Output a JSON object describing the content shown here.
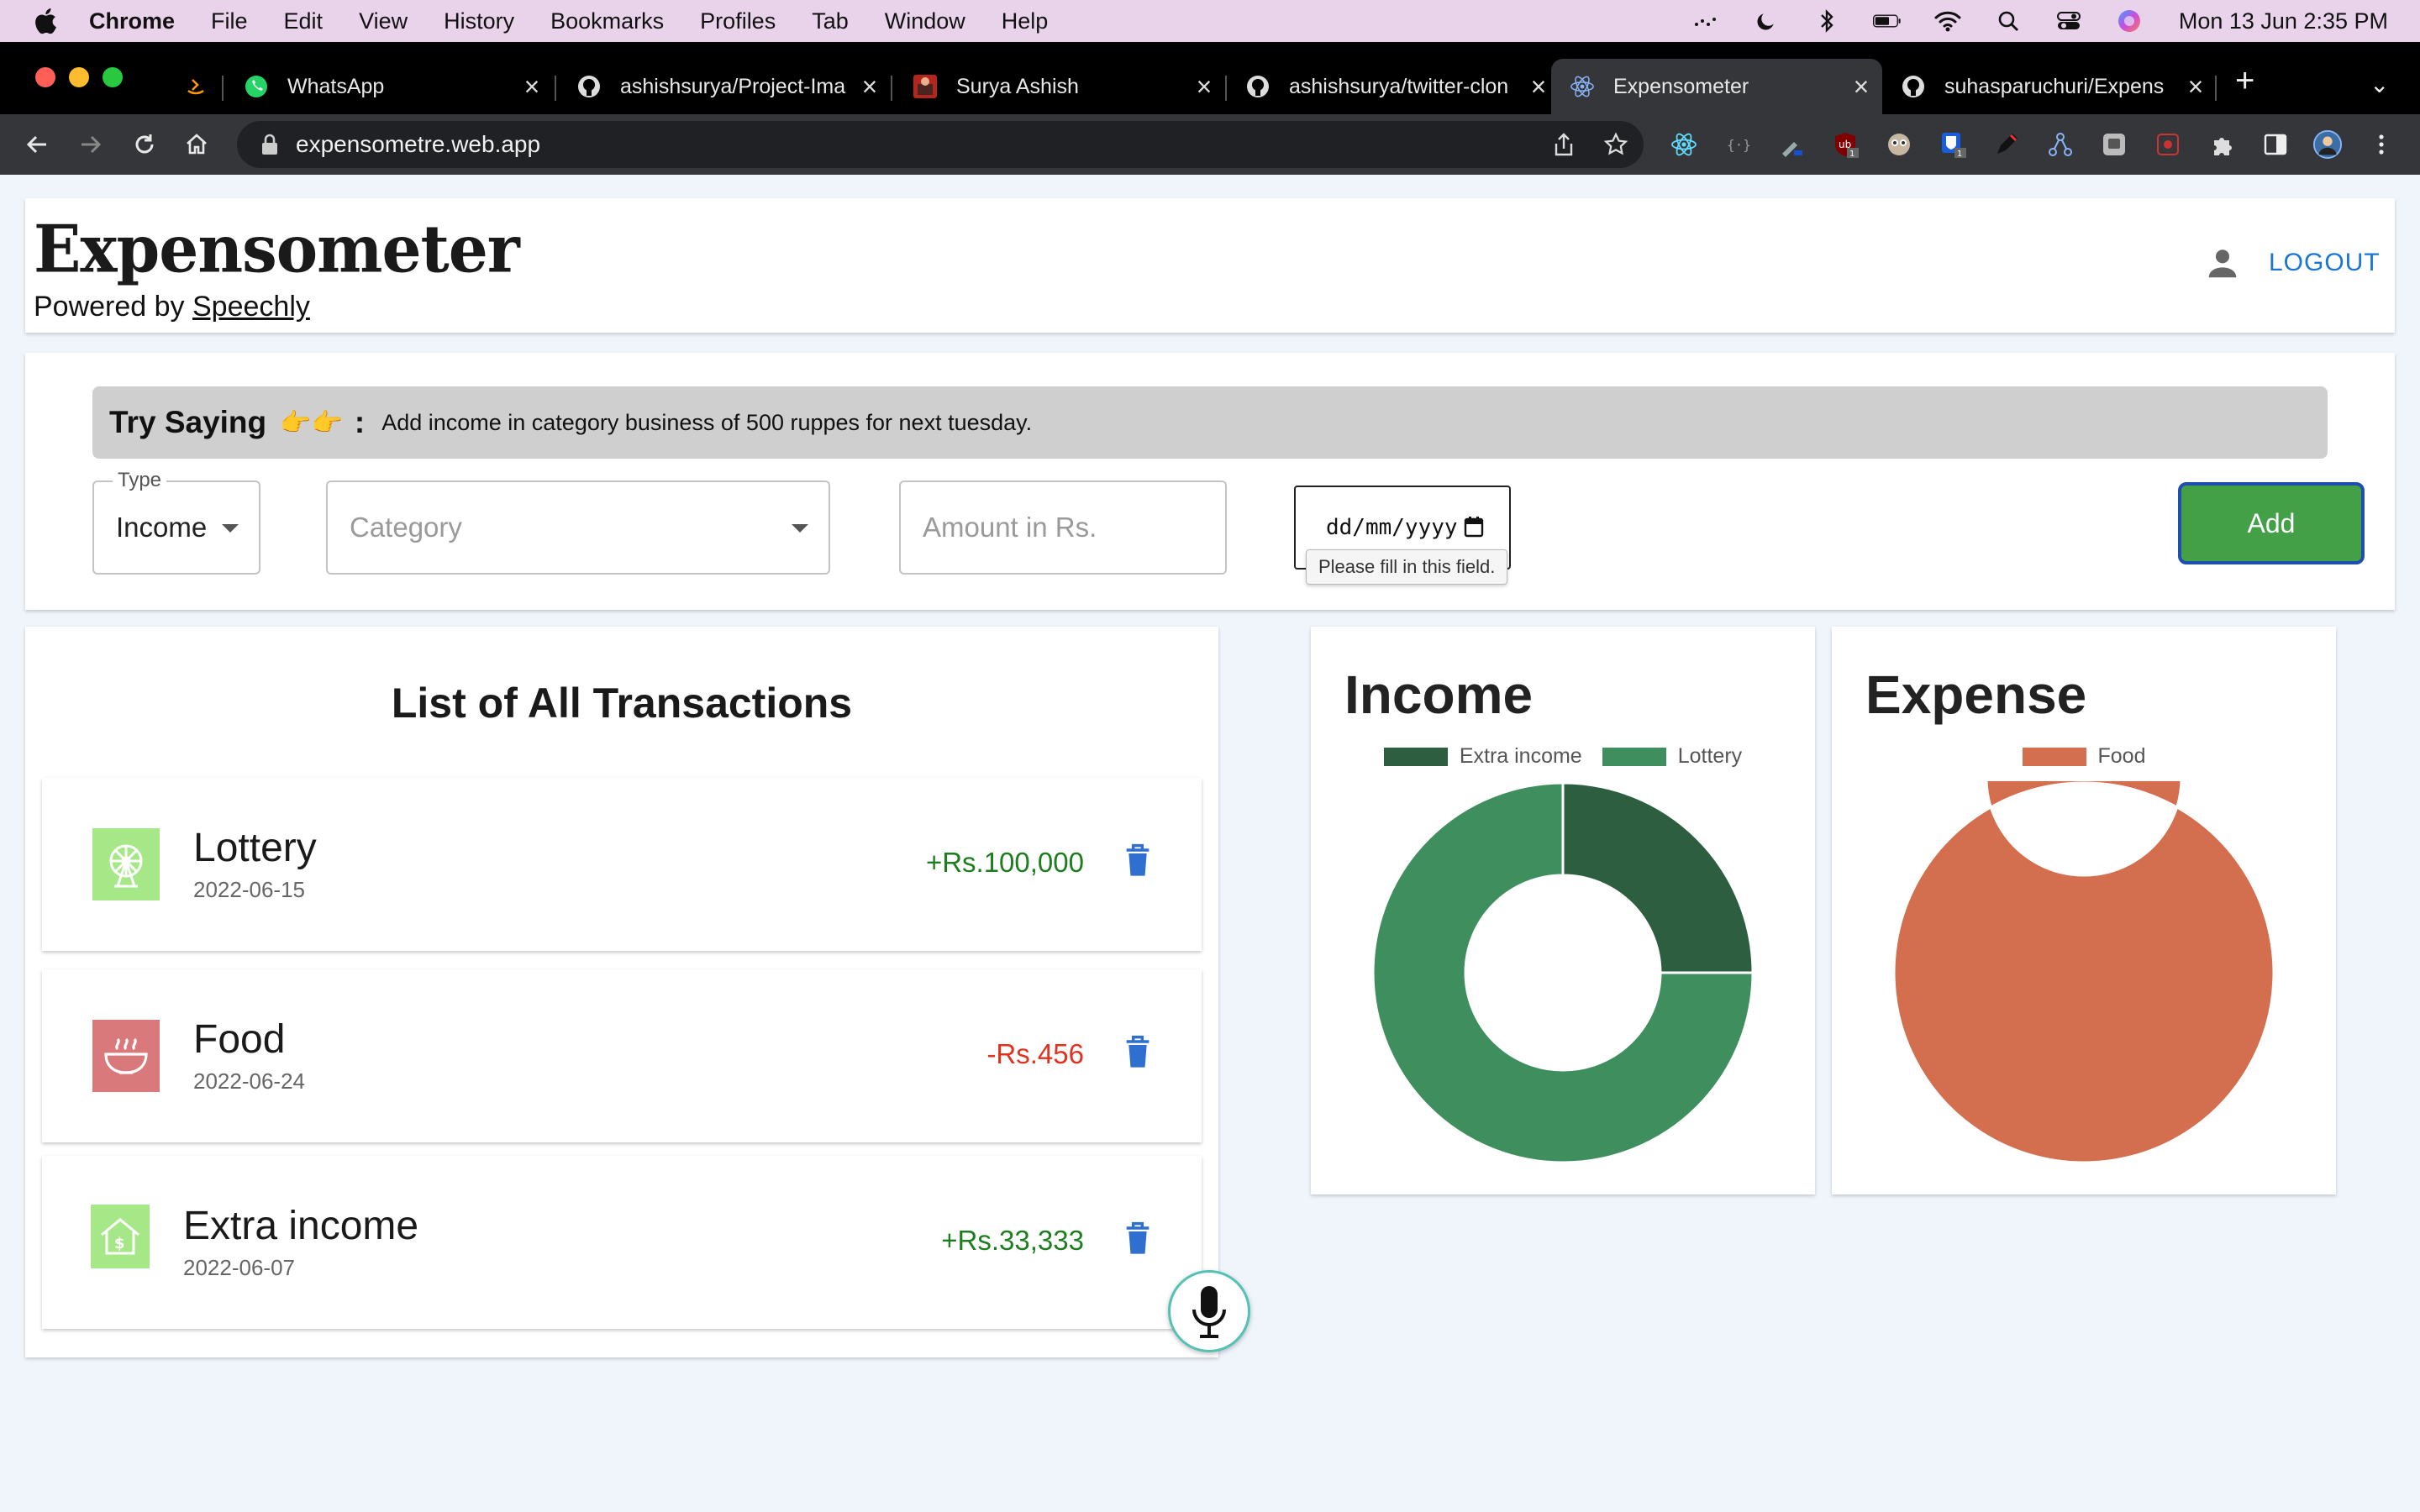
{
  "menubar": {
    "app": "Chrome",
    "items": [
      "File",
      "Edit",
      "View",
      "History",
      "Bookmarks",
      "Profiles",
      "Tab",
      "Window",
      "Help"
    ],
    "clock": "Mon 13 Jun  2:35 PM"
  },
  "browser": {
    "tabs": [
      {
        "title": "",
        "icon": "amazon-icon",
        "active": false
      },
      {
        "title": "WhatsApp",
        "icon": "whatsapp-icon",
        "active": false
      },
      {
        "title": "ashishsurya/Project-Ima",
        "icon": "github-icon",
        "active": false
      },
      {
        "title": "Surya Ashish",
        "icon": "profile-favicon",
        "active": false
      },
      {
        "title": "ashishsurya/twitter-clon",
        "icon": "github-icon",
        "active": false
      },
      {
        "title": "Expensometer",
        "icon": "react-icon",
        "active": true
      },
      {
        "title": "suhasparuchuri/Expens",
        "icon": "github-icon",
        "active": false
      }
    ],
    "url": "expensometre.web.app"
  },
  "header": {
    "logo": "Expensometer",
    "powered_prefix": "Powered by",
    "powered_link": "Speechly",
    "logout": "LOGOUT"
  },
  "form": {
    "try_label": "Try Saying",
    "try_colon": ":",
    "try_text": "Add income in category business of 500 ruppes for next tuesday.",
    "type_legend": "Type",
    "type_value": "Income",
    "category_placeholder": "Category",
    "amount_placeholder": "Amount in Rs.",
    "date_placeholder": "dd/mm/yyyy",
    "tooltip": "Please fill in this field.",
    "add_label": "Add"
  },
  "transactions": {
    "title": "List of All Transactions",
    "items": [
      {
        "name": "Lottery",
        "date": "2022-06-15",
        "amount": "+Rs.100,000",
        "type": "income",
        "icon": "ferris-wheel-icon",
        "color": "#a6e887"
      },
      {
        "name": "Food",
        "date": "2022-06-24",
        "amount": "-Rs.456",
        "type": "expense",
        "icon": "bowl-icon",
        "color": "#d9797b"
      },
      {
        "name": "Extra income",
        "date": "2022-06-07",
        "amount": "+Rs.33,333",
        "type": "income",
        "icon": "money-house-icon",
        "color": "#a6e887"
      }
    ]
  },
  "colors": {
    "income_text": "#1e7d1e",
    "expense_text": "#e0321e",
    "delete_icon": "#2f6fd0",
    "accent": "#1976d2",
    "add_button": "#43a047"
  },
  "chart_data": [
    {
      "type": "pie",
      "title": "Income",
      "categories": [
        "Extra income",
        "Lottery"
      ],
      "values": [
        33333,
        100000
      ],
      "colors": [
        "#2c5e3f",
        "#3f8f5e"
      ],
      "legend": "top"
    },
    {
      "type": "pie",
      "title": "Expense",
      "categories": [
        "Food"
      ],
      "values": [
        456
      ],
      "colors": [
        "#d36e4f"
      ],
      "legend": "top"
    }
  ]
}
